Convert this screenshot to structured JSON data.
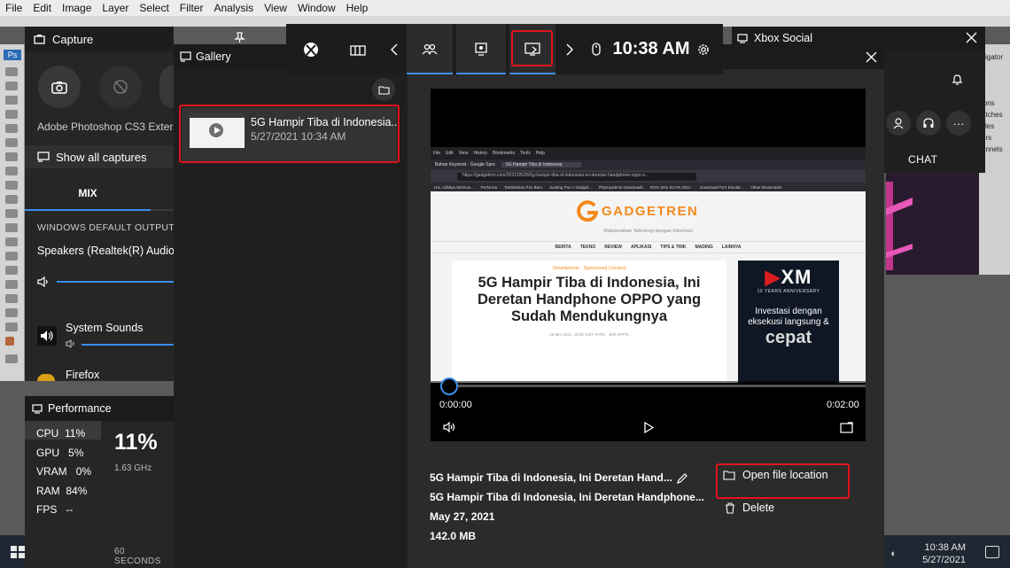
{
  "photoshop": {
    "menu": [
      "File",
      "Edit",
      "Image",
      "Layer",
      "Select",
      "Filter",
      "Analysis",
      "View",
      "Window",
      "Help"
    ],
    "tool_logo": "Ps",
    "right_panel_items": [
      "vigator",
      "o",
      "ions",
      "atches",
      "yles",
      "ers",
      "annels"
    ]
  },
  "capture": {
    "title": "Capture",
    "app_name": "Adobe Photoshop CS3 Exter",
    "show_all": "Show all captures"
  },
  "audio": {
    "tab": "MIX",
    "output_label": "WINDOWS DEFAULT OUTPUT",
    "device": "Speakers (Realtek(R) Audio",
    "sources": [
      "System Sounds",
      "Firefox"
    ]
  },
  "performance": {
    "title": "Performance",
    "metrics": [
      {
        "label": "CPU",
        "value": "11%"
      },
      {
        "label": "GPU",
        "value": "5%"
      },
      {
        "label": "VRAM",
        "value": "0%"
      },
      {
        "label": "RAM",
        "value": "84%"
      },
      {
        "label": "FPS",
        "value": "--"
      }
    ],
    "big_value": "11%",
    "freq": "1.63 GHz",
    "timespan": "60 SECONDS"
  },
  "gamebar": {
    "time": "10:38 AM"
  },
  "gallery": {
    "title": "Gallery",
    "item": {
      "title": "5G Hampir Tiba di Indonesia...",
      "date": "5/27/2021 10:34 AM"
    },
    "player": {
      "time_current": "0:00:00",
      "time_total": "0:02:00",
      "progress": 0
    },
    "details": {
      "title": "5G Hampir Tiba di Indonesia, Ini Deretan Hand...",
      "filename": "5G Hampir Tiba di Indonesia, Ini Deretan Handphone...",
      "date": "May 27, 2021",
      "size": "142.0 MB"
    },
    "actions": {
      "open_location": "Open file location",
      "delete": "Delete"
    }
  },
  "browser": {
    "menu": [
      "File",
      "Edit",
      "View",
      "History",
      "Bookmarks",
      "Tools",
      "Help"
    ],
    "tabs": [
      "Bahan Keyword - Google Spre",
      "5G Hampir Tiba di Indonesia"
    ],
    "url": "https://gadgetren.com/2021/05/26/5g-hampir-tiba-di-indonesia-ini-deretan-handphone-oppo-s...",
    "bookmarks": [
      "Hai, Adhitya Wisnuw...",
      "Performa",
      "Tambahkan Pos Baru",
      "Sunting Pos < Gadget...",
      "Phpmyadmin Downloads",
      "ROG Strix SCAR 2021 -",
      "Download PSX Emulat...",
      "Other Bookmarks"
    ],
    "site_logo": "GADGETREN",
    "tagline": "Maksimalkan Teknologi dengan Informasi",
    "nav": [
      "BERITA",
      "TEKNO",
      "REVIEW",
      "APLIKASI",
      "TIPS & TRIK",
      "MADING",
      "LAINNYA"
    ],
    "category": "Smartphone · Sponsored Content",
    "headline": "5G Hampir Tiba di Indonesia, Ini Deretan Handphone OPPO yang Sudah Mendukungnya",
    "byline": "26 Mei 2021, 19:33 GMT+0700 · oleh OPPO",
    "ad_logo": "XM",
    "ad_anniv": "10 YEARS ANNIVERSARY",
    "ad_text": "Investasi dengan eksekusi langsung &",
    "ad_word": "cepat"
  },
  "xbox": {
    "title": "Xbox Social",
    "chat": "CHAT"
  },
  "taskbar": {
    "time": "10:38 AM",
    "date": "5/27/2021"
  },
  "colors": {
    "accent": "#3b8eea",
    "highlight": "#e0141e",
    "gadgetren_orange": "#f28a1b"
  }
}
